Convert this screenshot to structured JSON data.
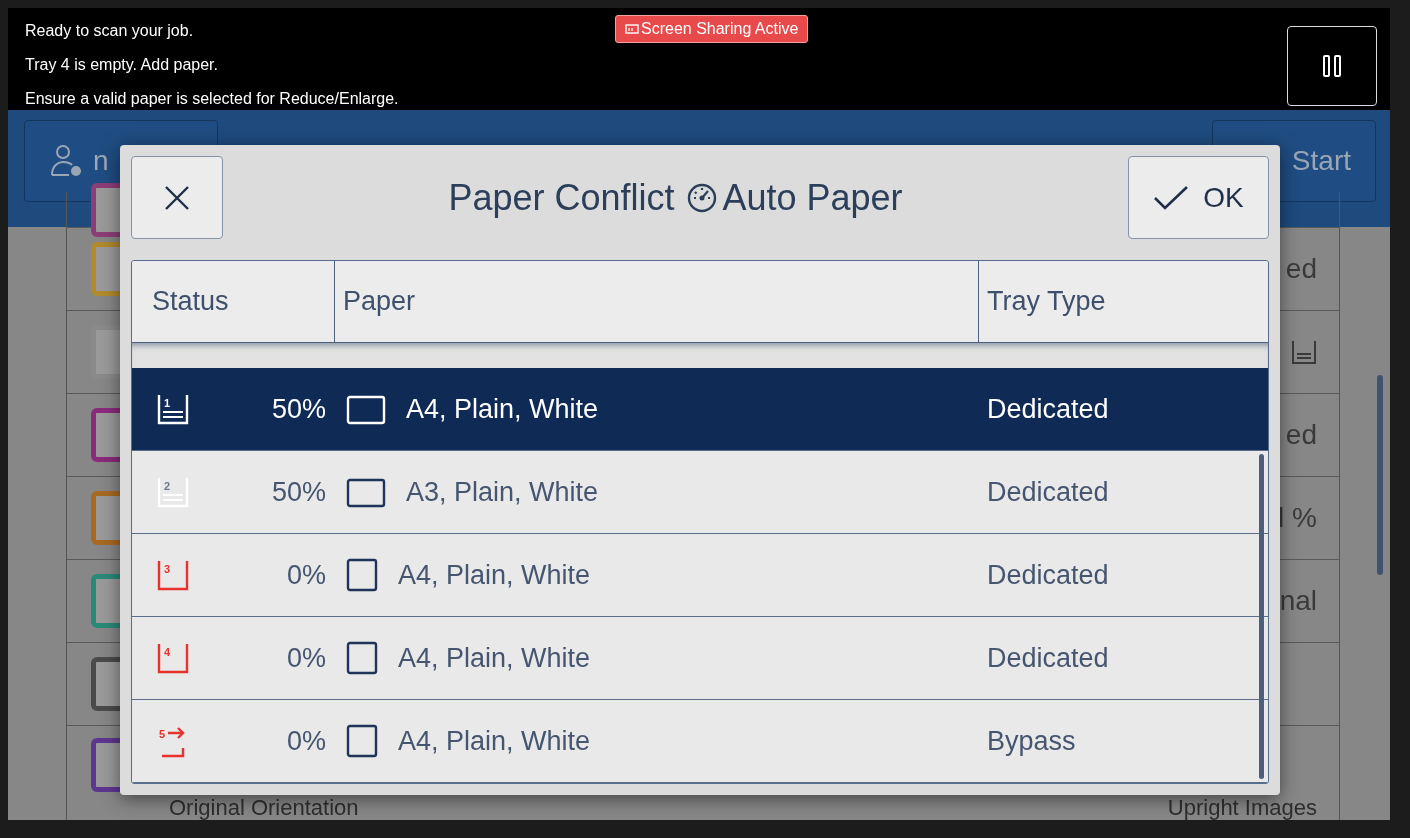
{
  "status_messages": [
    "Ready to scan your job.",
    "Tray 4 is empty.  Add paper.",
    "Ensure a valid paper is selected for Reduce/Enlarge."
  ],
  "sharing_badge": "Screen Sharing Active",
  "header": {
    "user_button": "n",
    "start_button": "Start"
  },
  "background_list": [
    {
      "kind": "blank",
      "color": "#8c3d78"
    },
    {
      "kind": "text",
      "color": "#b08a2c",
      "value": "ed"
    },
    {
      "kind": "tray",
      "color": "#8a8a8a"
    },
    {
      "kind": "text",
      "color": "#8a2a7c",
      "value": "ed"
    },
    {
      "kind": "text",
      "color": "#a86a22",
      "value": "l %"
    },
    {
      "kind": "text",
      "color": "#2a8a78",
      "value": "nal"
    },
    {
      "kind": "blank",
      "color": "#4a4a4a"
    },
    {
      "kind": "text",
      "color": "#5e3690",
      "label": "Original Orientation",
      "value": "Upright Images"
    }
  ],
  "dialog": {
    "title": "Paper Conflict",
    "subtitle": "Auto Paper",
    "ok": "OK",
    "columns": [
      "Status",
      "Paper",
      "Tray Type"
    ],
    "rows": [
      {
        "kind": "tray",
        "tray": "1",
        "empty": false,
        "percent": "50%",
        "landscape": true,
        "paper": "A4, Plain, White",
        "tray_type": "Dedicated",
        "selected": true
      },
      {
        "kind": "tray",
        "tray": "2",
        "empty": false,
        "percent": "50%",
        "landscape": true,
        "paper": "A3, Plain, White",
        "tray_type": "Dedicated",
        "selected": false
      },
      {
        "kind": "tray",
        "tray": "3",
        "empty": true,
        "percent": "0%",
        "landscape": false,
        "paper": "A4, Plain, White",
        "tray_type": "Dedicated",
        "selected": false
      },
      {
        "kind": "tray",
        "tray": "4",
        "empty": true,
        "percent": "0%",
        "landscape": false,
        "paper": "A4, Plain, White",
        "tray_type": "Dedicated",
        "selected": false
      },
      {
        "kind": "bypass",
        "tray": "5",
        "empty": true,
        "percent": "0%",
        "landscape": false,
        "paper": "A4, Plain, White",
        "tray_type": "Bypass",
        "selected": false
      }
    ]
  }
}
